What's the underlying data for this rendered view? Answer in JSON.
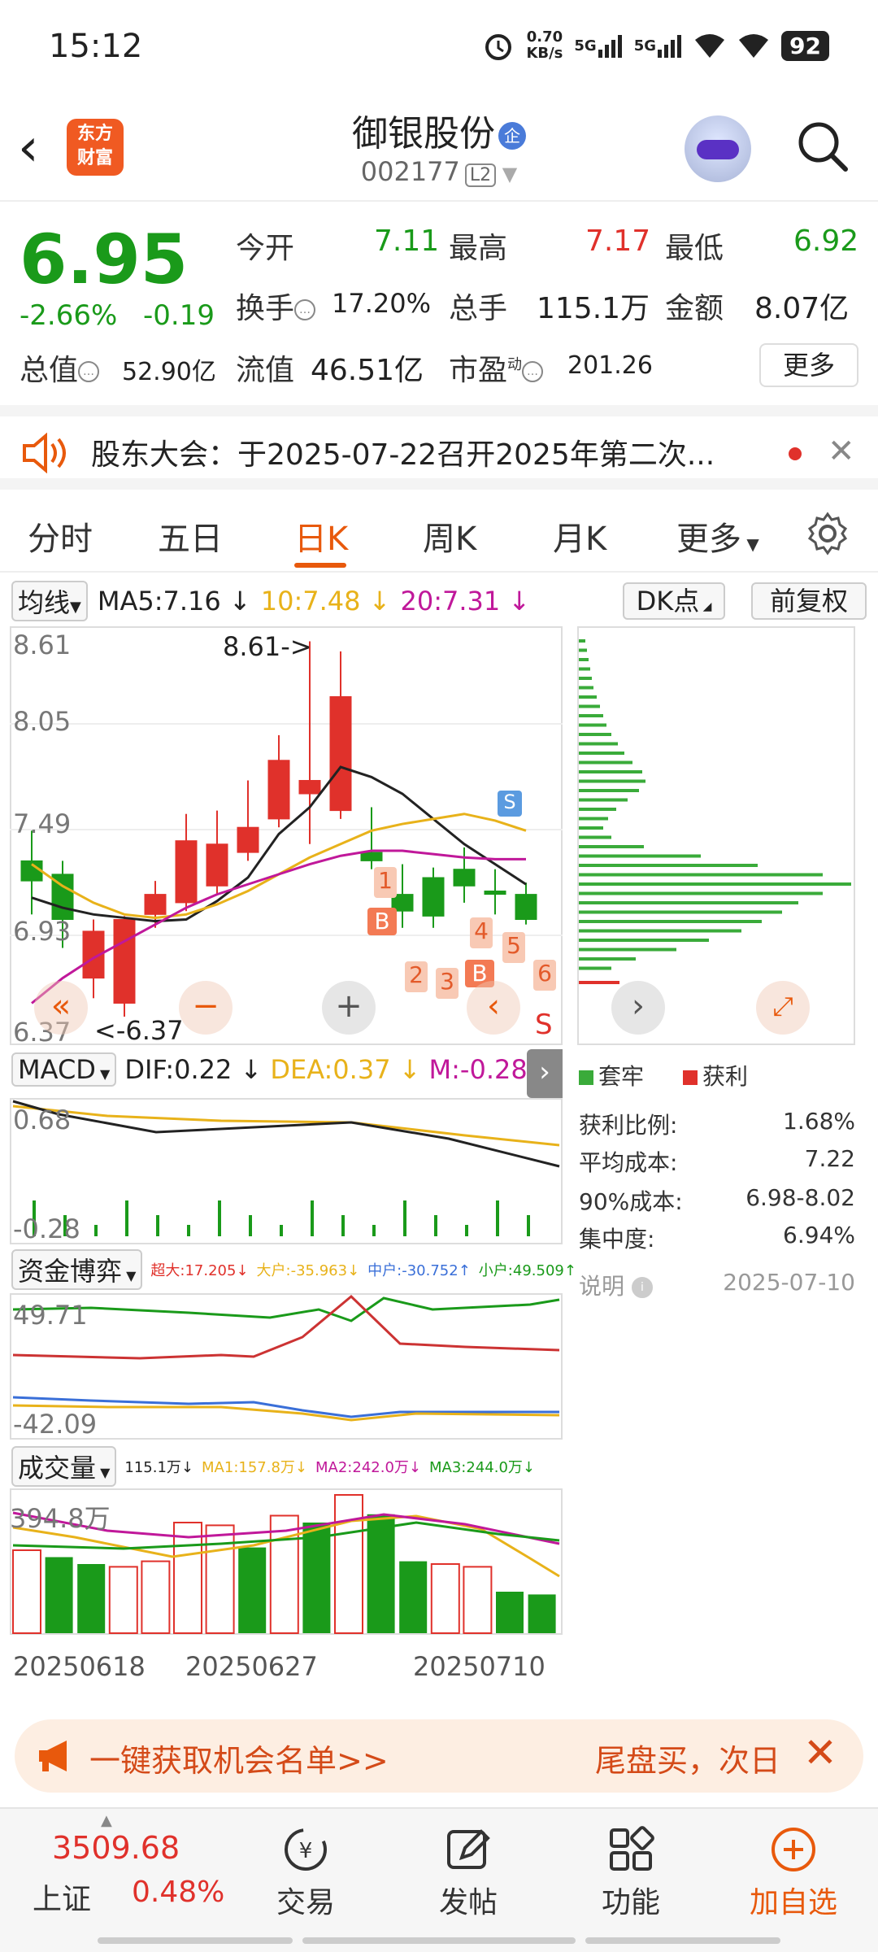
{
  "status": {
    "time": "15:12",
    "net_speed_top": "0.70",
    "net_speed_unit": "KB/s",
    "sim1": "5G",
    "sim2": "5G",
    "battery": "92"
  },
  "header": {
    "logo_line1": "东方",
    "logo_line2": "财富",
    "stock_name": "御银股份",
    "badge": "企",
    "code": "002177",
    "level": "L2"
  },
  "quote": {
    "price": "6.95",
    "change_pct": "-2.66%",
    "change_abs": "-0.19",
    "open_label": "今开",
    "open": "7.11",
    "high_label": "最高",
    "high": "7.17",
    "low_label": "最低",
    "low": "6.92",
    "turnover_label": "换手",
    "turnover": "17.20%",
    "volume_label": "总手",
    "volume": "115.1万",
    "amount_label": "金额",
    "amount": "8.07亿",
    "mktcap_label": "总值",
    "mktcap": "52.90亿",
    "float_label": "流值",
    "float": "46.51亿",
    "pe_label": "市盈",
    "pe_sup": "动",
    "pe": "201.26",
    "more": "更多"
  },
  "notice": {
    "text": "股东大会：于2025-07-22召开2025年第二次..."
  },
  "tabs": [
    "分时",
    "五日",
    "日K",
    "周K",
    "月K",
    "更多"
  ],
  "ma": {
    "selector": "均线",
    "ma5": "MA5:7.16 ↓",
    "ma10": "10:7.48 ↓",
    "ma20": "20:7.31 ↓",
    "dk": "DK点",
    "fq": "前复权"
  },
  "kline": {
    "y_labels": [
      "8.61",
      "8.05",
      "7.49",
      "6.93",
      "6.37"
    ],
    "high_marker": "8.61->",
    "low_marker": "<-6.37",
    "s_marker": "S",
    "s_marker2": "S",
    "signals": [
      "1",
      "B",
      "2",
      "3",
      "B",
      "4",
      "5",
      "6"
    ]
  },
  "chips": {
    "legend_trap": "套牢",
    "legend_profit": "获利",
    "rows": [
      {
        "label": "获利比例:",
        "value": "1.68%"
      },
      {
        "label": "平均成本:",
        "value": "7.22"
      },
      {
        "label": "90%成本:",
        "value": "6.98-8.02"
      },
      {
        "label": "集中度:",
        "value": "6.94%"
      }
    ],
    "note_label": "说明",
    "date": "2025-07-10"
  },
  "macd": {
    "selector": "MACD",
    "dif": "DIF:0.22 ↓",
    "dea": "DEA:0.37 ↓",
    "m": "M:-0.28 ↓",
    "ytop": "0.68",
    "ybot": "-0.28"
  },
  "funds": {
    "selector": "资金博弈",
    "super": "超大:17.205↓",
    "big": "大户:-35.963↓",
    "mid": "中户:-30.752↑",
    "small": "小户:49.509↑",
    "ytop": "49.71",
    "ybot": "-42.09"
  },
  "vol": {
    "selector": "成交量",
    "v": "115.1万↓",
    "ma1": "MA1:157.8万↓",
    "ma2": "MA2:242.0万↓",
    "ma3": "MA3:244.0万↓",
    "ytop": "394.8万",
    "dates": [
      "20250618",
      "20250627",
      "20250710"
    ]
  },
  "banner": {
    "left": "一键获取机会名单>>",
    "right": "尾盘买，次日"
  },
  "bottom": {
    "index_value": "3509.68",
    "index_name": "上证",
    "index_pct": "0.48%",
    "items": [
      "交易",
      "发帖",
      "功能",
      "加自选"
    ]
  },
  "colors": {
    "up": "#e0312b",
    "down": "#1a9a1a",
    "accent": "#e8590c"
  }
}
